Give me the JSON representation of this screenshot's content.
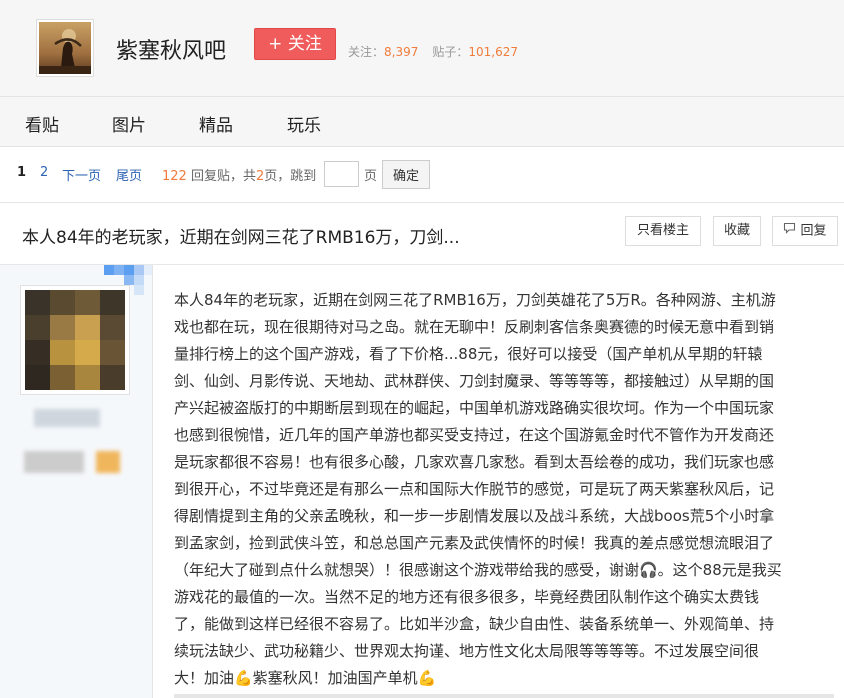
{
  "forum": {
    "name": "紫塞秋风吧",
    "follow_label": "+ 关注",
    "stats": {
      "followers_label": "关注：",
      "followers": "8,397",
      "posts_label": "贴子：",
      "posts": "101,627"
    }
  },
  "nav": {
    "items": [
      "看贴",
      "图片",
      "精品",
      "玩乐"
    ]
  },
  "pager": {
    "current_page": "1",
    "page_2": "2",
    "next_label": "下一页",
    "last_label": "尾页",
    "reply_count": "122",
    "reply_label": "回复贴，共",
    "total_pages": "2",
    "pages_suffix": "页，跳到",
    "page_unit": "页",
    "jump_value": "",
    "confirm_label": "确定"
  },
  "thread": {
    "title": "本人84年的老玩家，近期在剑网三花了RMB16万，刀剑...",
    "buttons": {
      "only_op": "只看楼主",
      "favorite": "收藏",
      "reply": "回复"
    }
  },
  "post": {
    "lines": [
      "本人84年的老玩家，近期在剑网三花了RMB16万，刀剑英雄花了5万R。各种网游、主机游",
      "戏也都在玩，现在很期待对马之岛。就在无聊中！反刷刺客信条奥赛德的时候无意中看到销",
      "量排行榜上的这个国产游戏，看了下价格...88元，很好可以接受（国产单机从早期的轩辕",
      "剑、仙剑、月影传说、天地劫、武林群侠、刀剑封魔录、等等等等，都接触过）从早期的国",
      "产兴起被盗版打的中期断层到现在的崛起，中国单机游戏路确实很坎坷。作为一个中国玩家",
      "也感到很惋惜，近几年的国产单游也都买受支持过，在这个国游氪金时代不管作为开发商还",
      "是玩家都很不容易！也有很多心酸，几家欢喜几家愁。看到太吾绘卷的成功，我们玩家也感",
      "到很开心，不过毕竟还是有那么一点和国际大作脱节的感觉，可是玩了两天紫塞秋风后，记",
      "得剧情提到主角的父亲孟晚秋，和一步一步剧情发展以及战斗系统，大战boos荒5个小时拿",
      "到孟家剑，捡到武侠斗笠，和总总国产元素及武侠情怀的时候！我真的差点感觉想流眼泪了",
      "（年纪大了碰到点什么就想哭）！很感谢这个游戏带给我的感受，谢谢🎧。这个88元是我买",
      "游戏花的最值的一次。当然不足的地方还有很多很多，毕竟经费团队制作这个确实太费钱",
      "了，能做到这样已经很不容易了。比如半沙盒，缺少自由性、装备系统单一、外观简单、持",
      "续玩法缺少、武功秘籍少、世界观太拘谨、地方性文化太局限等等等等。不过发展空间很",
      "大！加油💪紫塞秋风！加油国产单机💪"
    ]
  }
}
